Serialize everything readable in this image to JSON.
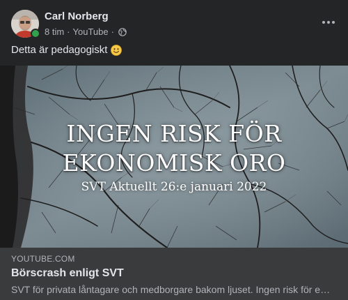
{
  "post": {
    "author": {
      "name": "Carl Norberg",
      "online": true
    },
    "meta": {
      "time": "8 tim",
      "separator": "·",
      "source": "YouTube",
      "separator2": "·",
      "audience_icon": "globe-icon"
    },
    "more_icon": "more-horizontal-icon",
    "text": "Detta är pedagogiskt",
    "emoji_icon": "smiling-face-emoji-icon"
  },
  "link_preview": {
    "image": {
      "title_line1": "INGEN RISK FÖR",
      "title_line2": "EKONOMISK ORO",
      "subtitle": "SVT Aktuellt 26:e januari 2022"
    },
    "domain": "YOUTUBE.COM",
    "title": "Börscrash enligt SVT",
    "description": "SVT för privata låntagare och medborgare bakom ljuset. Ingen risk för ekonomisk oro."
  },
  "colors": {
    "background": "#242526",
    "footer": "#3a3b3c",
    "primary_text": "#e4e6eb",
    "secondary_text": "#b0b3b8",
    "online": "#31a24c"
  }
}
